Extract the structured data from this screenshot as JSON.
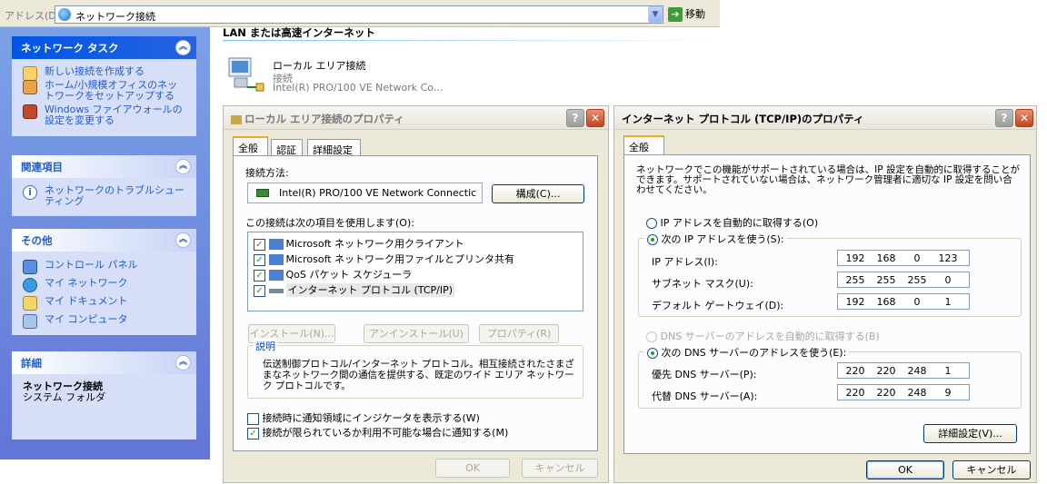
{
  "address_bar": {
    "label": "アドレス(D)",
    "value": "ネットワーク接続",
    "go_label": "移動"
  },
  "task_pane": {
    "network_tasks": {
      "title": "ネットワーク タスク",
      "items": [
        "新しい接続を作成する",
        "ホーム/小規模オフィスのネットワークをセットアップする",
        "Windows ファイアウォールの設定を変更する"
      ]
    },
    "related": {
      "title": "関連項目",
      "items": [
        "ネットワークのトラブルシューティング"
      ]
    },
    "other": {
      "title": "その他",
      "items": [
        "コントロール パネル",
        "マイ ネットワーク",
        "マイ ドキュメント",
        "マイ コンピュータ"
      ]
    },
    "details": {
      "title": "詳細",
      "name": "ネットワーク接続",
      "type": "システム フォルダ"
    }
  },
  "content": {
    "group_title": "LAN または高速インターネット",
    "connection": {
      "name": "ローカル エリア接続",
      "status": "接続",
      "device": "Intel(R) PRO/100 VE Network Co..."
    }
  },
  "lan_dialog": {
    "title": "ローカル エリア接続のプロパティ",
    "tabs": [
      "全般",
      "認証",
      "詳細設定"
    ],
    "connect_using_label": "接続方法:",
    "adapter": "Intel(R) PRO/100 VE Network Connectic",
    "configure_button": "構成(C)...",
    "items_label": "この接続は次の項目を使用します(O):",
    "items": [
      {
        "label": "Microsoft ネットワーク用クライアント",
        "checked": true
      },
      {
        "label": "Microsoft ネットワーク用ファイルとプリンタ共有",
        "checked": true
      },
      {
        "label": "QoS パケット スケジューラ",
        "checked": true
      },
      {
        "label": "インターネット プロトコル (TCP/IP)",
        "checked": true
      }
    ],
    "install_button": "インストール(N)...",
    "uninstall_button": "アンインストール(U)",
    "properties_button": "プロパティ(R)",
    "description_title": "説明",
    "description": "伝送制御プロトコル/インターネット プロトコル。相互接続されたさまざまなネットワーク間の通信を提供する、既定のワイド エリア ネットワーク プロトコルです。",
    "show_icon_label": "接続時に通知領域にインジケータを表示する(W)",
    "show_icon_checked": false,
    "notify_label": "接続が限られているか利用不可能な場合に通知する(M)",
    "notify_checked": true,
    "ok_button": "OK",
    "cancel_button": "キャンセル"
  },
  "tcpip_dialog": {
    "title": "インターネット プロトコル (TCP/IP)のプロパティ",
    "tab": "全般",
    "intro": "ネットワークでこの機能がサポートされている場合は、IP 設定を自動的に取得することができます。サポートされていない場合は、ネットワーク管理者に適切な IP 設定を問い合わせてください。",
    "auto_ip_label": "IP アドレスを自動的に取得する(O)",
    "manual_ip_label": "次の IP アドレスを使う(S):",
    "ip_label": "IP アドレス(I):",
    "ip_value": [
      "192",
      "168",
      "0",
      "123"
    ],
    "subnet_label": "サブネット マスク(U):",
    "subnet_value": [
      "255",
      "255",
      "255",
      "0"
    ],
    "gateway_label": "デフォルト ゲートウェイ(D):",
    "gateway_value": [
      "192",
      "168",
      "0",
      "1"
    ],
    "auto_dns_label": "DNS サーバーのアドレスを自動的に取得する(B)",
    "manual_dns_label": "次の DNS サーバーのアドレスを使う(E):",
    "preferred_dns_label": "優先 DNS サーバー(P):",
    "preferred_dns_value": [
      "220",
      "220",
      "248",
      "1"
    ],
    "alternate_dns_label": "代替 DNS サーバー(A):",
    "alternate_dns_value": [
      "220",
      "220",
      "248",
      "9"
    ],
    "advanced_button": "詳細設定(V)...",
    "ok_button": "OK",
    "cancel_button": "キャンセル"
  }
}
